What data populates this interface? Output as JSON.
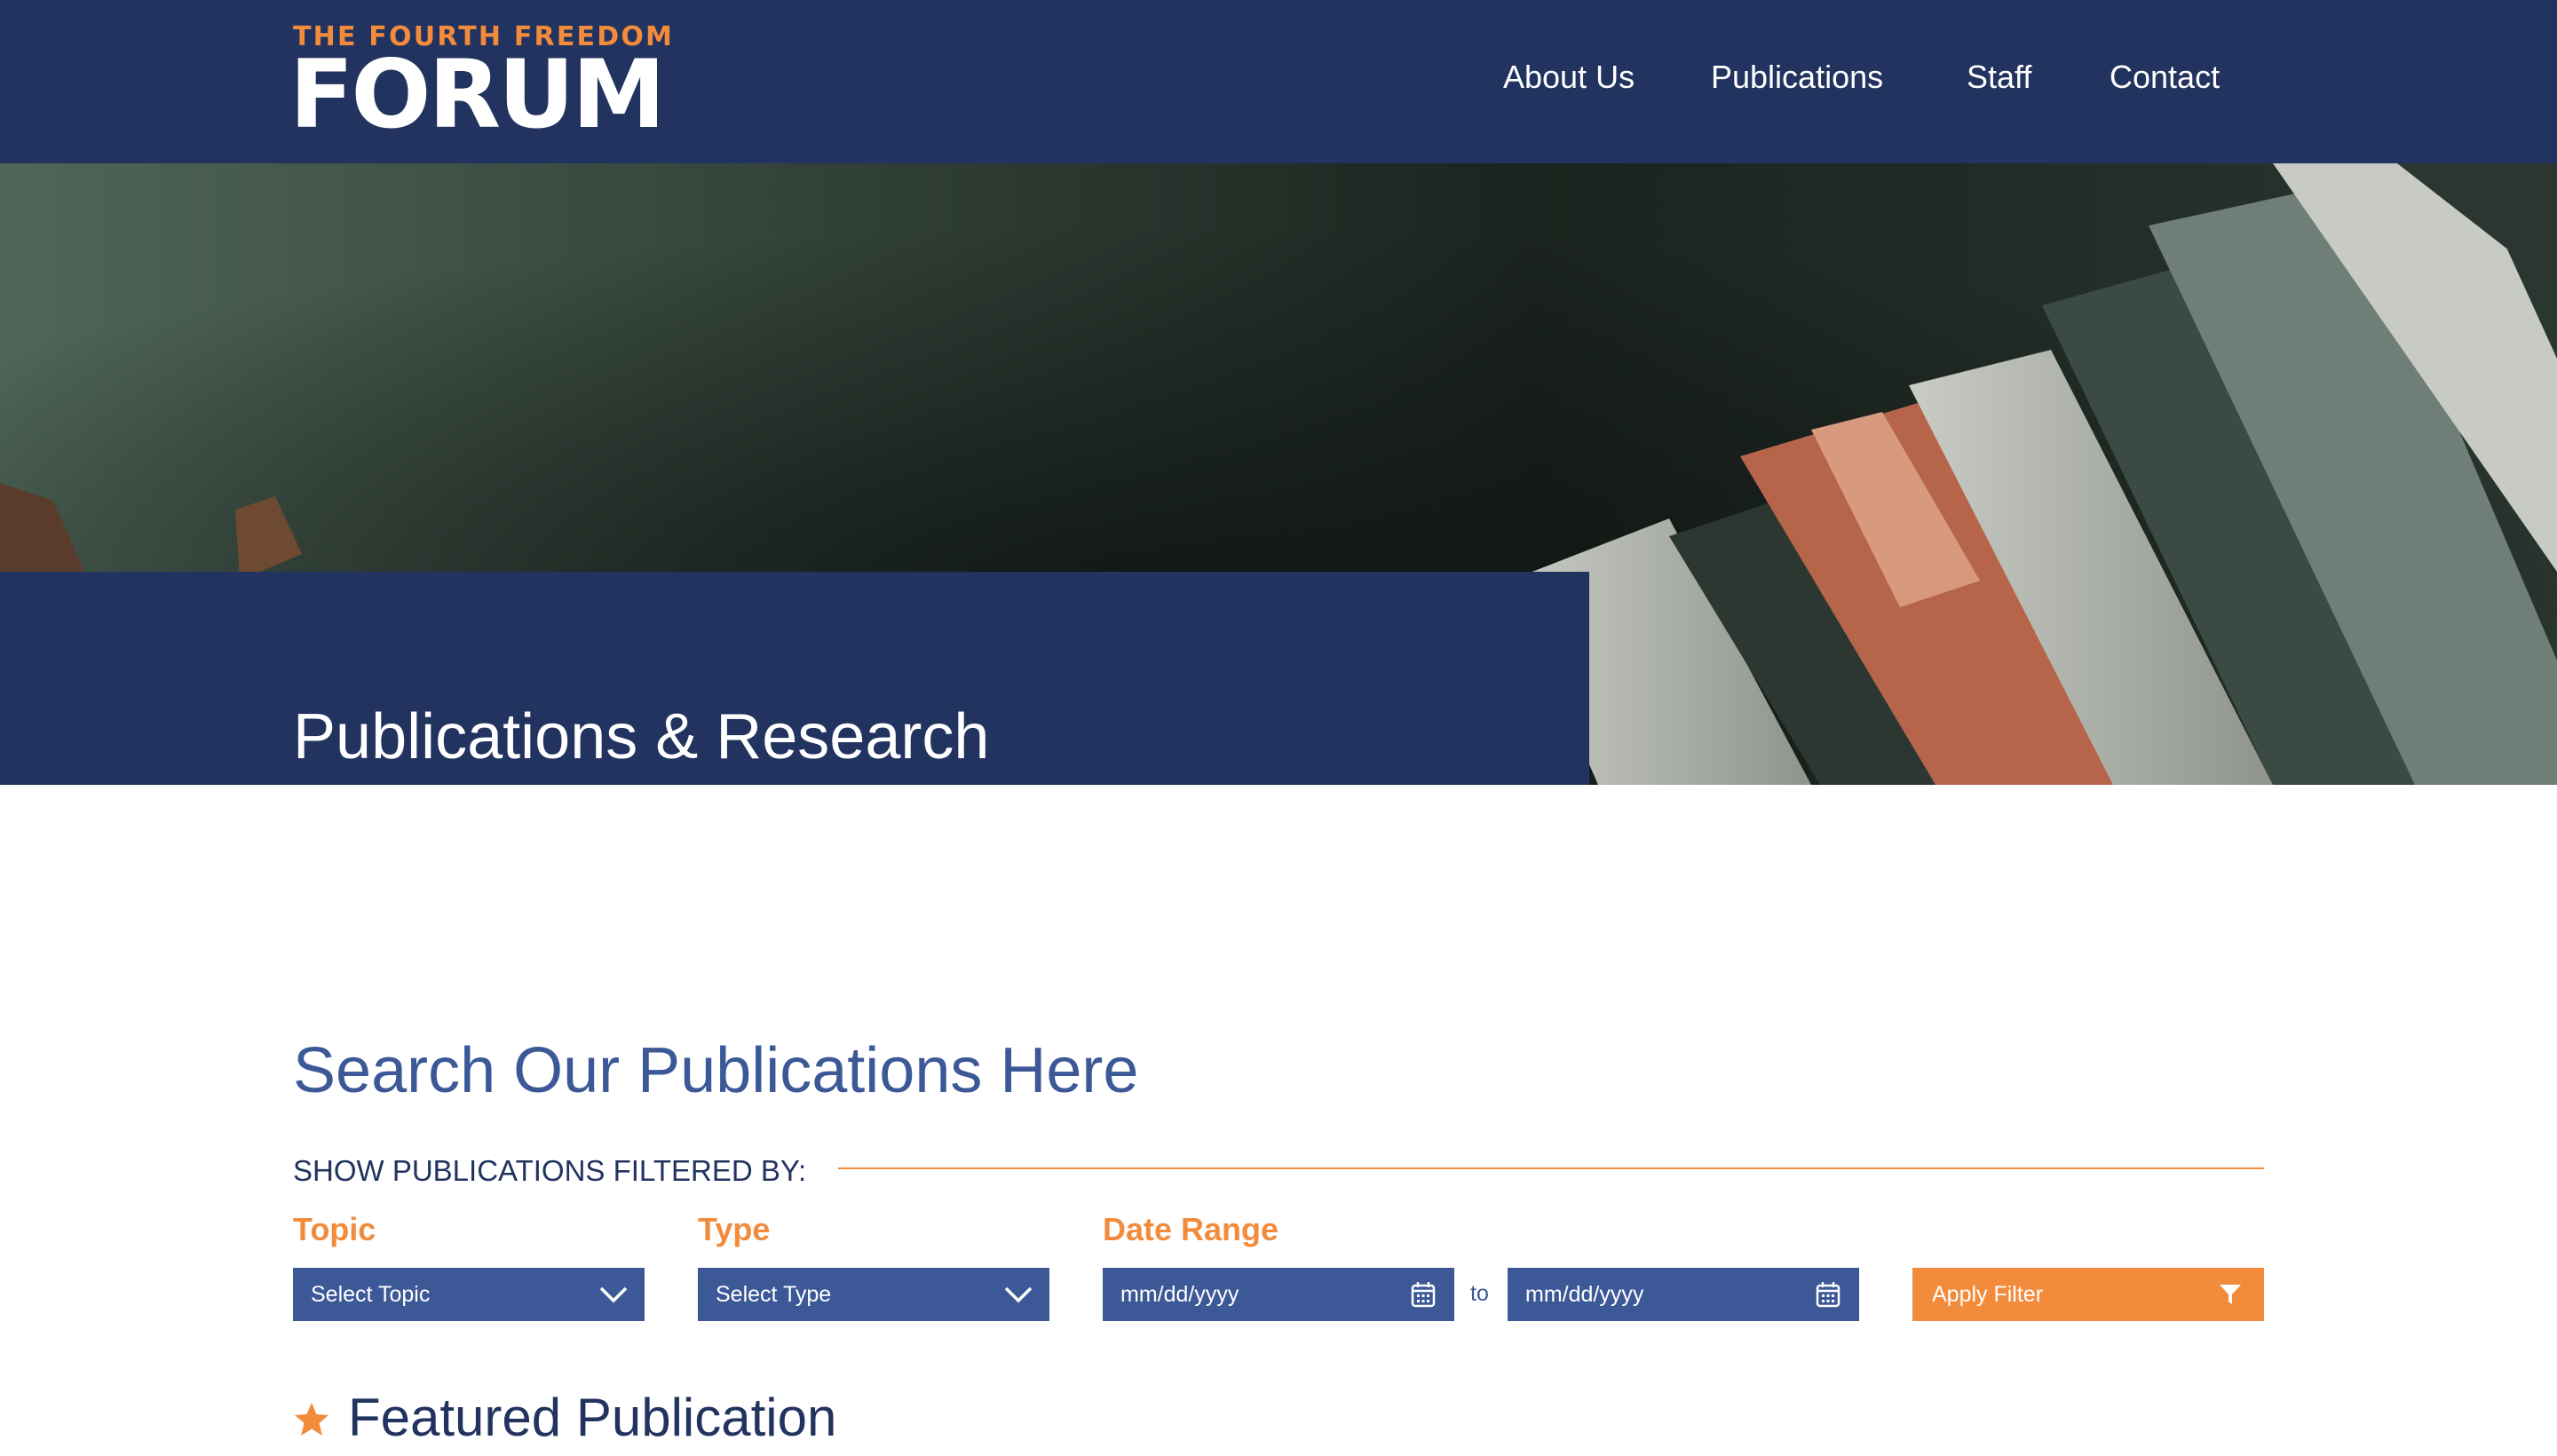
{
  "header": {
    "logo": {
      "top_text": "THE FOURTH FREEDOM",
      "main_text": "FORUM"
    },
    "nav": [
      {
        "label": "About Us"
      },
      {
        "label": "Publications"
      },
      {
        "label": "Staff"
      },
      {
        "label": "Contact"
      }
    ]
  },
  "hero": {
    "title": "Publications & Research"
  },
  "search": {
    "heading": "Search Our Publications Here",
    "filter_label": "SHOW PUBLICATIONS FILTERED BY:",
    "topic": {
      "label": "Topic",
      "value": "Select Topic"
    },
    "type": {
      "label": "Type",
      "value": "Select Type"
    },
    "date_range": {
      "label": "Date Range",
      "from_placeholder": "mm/dd/yyyy",
      "to_label": "to",
      "to_placeholder": "mm/dd/yyyy"
    },
    "apply_label": "Apply Filter"
  },
  "featured": {
    "title": "Featured Publication"
  },
  "icons": {
    "dropdown": "chevron-down-icon",
    "calendar": "calendar-icon",
    "filter": "filter-icon",
    "featured": "star-icon"
  },
  "colors": {
    "navy": "#22335f",
    "blue": "#3c5897",
    "orange": "#f28b3c",
    "white": "#ffffff"
  }
}
